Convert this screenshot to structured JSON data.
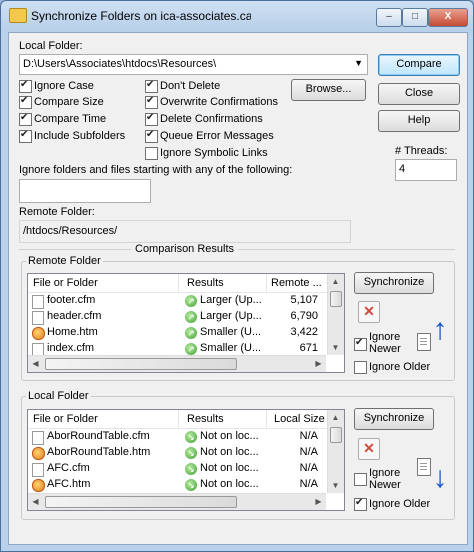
{
  "window": {
    "title": "Synchronize Folders on ica-associates.ca",
    "controls": {
      "minimize": "–",
      "maximize": "□",
      "close": "X"
    }
  },
  "local_folder": {
    "label": "Local Folder:",
    "value": "D:\\Users\\Associates\\htdocs\\Resources\\"
  },
  "buttons": {
    "compare": "Compare",
    "close": "Close",
    "help": "Help",
    "browse": "Browse..."
  },
  "options": [
    {
      "label": "Ignore Case",
      "checked": true
    },
    {
      "label": "Compare Size",
      "checked": true
    },
    {
      "label": "Compare Time",
      "checked": true
    },
    {
      "label": "Include Subfolders",
      "checked": true
    },
    {
      "label": "Don't Delete",
      "checked": true
    },
    {
      "label": "Overwrite Confirmations",
      "checked": true
    },
    {
      "label": "Delete Confirmations",
      "checked": true
    },
    {
      "label": "Queue Error Messages",
      "checked": true
    },
    {
      "label": "Ignore Symbolic Links",
      "checked": false
    }
  ],
  "threads": {
    "label": "# Threads:",
    "value": "4"
  },
  "ignore": {
    "label": "Ignore folders and files starting with any of the following:",
    "value": ""
  },
  "remote_folder": {
    "label": "Remote Folder:",
    "value": "/htdocs/Resources/"
  },
  "comparison_results": {
    "label": "Comparison Results"
  },
  "remote_panel": {
    "label": "Remote Folder",
    "columns": [
      "File or Folder",
      "Results",
      "Remote ..."
    ],
    "rows": [
      {
        "name": "footer.cfm",
        "result": "Larger (Up...",
        "size": "5,107"
      },
      {
        "name": "header.cfm",
        "result": "Larger (Up...",
        "size": "6,790"
      },
      {
        "name": "Home.htm",
        "result": "Smaller (U...",
        "size": "3,422"
      },
      {
        "name": "index.cfm",
        "result": "Smaller (U...",
        "size": "671"
      }
    ],
    "synchronize": "Synchronize",
    "delete": "✕",
    "ignore_newer": {
      "label": "Ignore Newer",
      "checked": true
    },
    "ignore_older": {
      "label": "Ignore Older",
      "checked": false
    },
    "direction": "upload-arrow-icon"
  },
  "local_panel": {
    "label": "Local Folder",
    "columns": [
      "File or Folder",
      "Results",
      "Local Size"
    ],
    "rows": [
      {
        "name": "AborRoundTable.cfm",
        "result": "Not on loc...",
        "size": "N/A"
      },
      {
        "name": "AborRoundTable.htm",
        "result": "Not on loc...",
        "size": "N/A"
      },
      {
        "name": "AFC.cfm",
        "result": "Not on loc...",
        "size": "N/A"
      },
      {
        "name": "AFC.htm",
        "result": "Not on loc...",
        "size": "N/A"
      }
    ],
    "synchronize": "Synchronize",
    "delete": "✕",
    "ignore_newer": {
      "label": "Ignore Newer",
      "checked": false
    },
    "ignore_older": {
      "label": "Ignore Older",
      "checked": true
    },
    "direction": "download-arrow-icon"
  },
  "colors": {
    "window_frame": "#b9d1ea",
    "client": "#f0f0f0",
    "arrow": "#1a55c9",
    "delete": "#d24a3a"
  }
}
